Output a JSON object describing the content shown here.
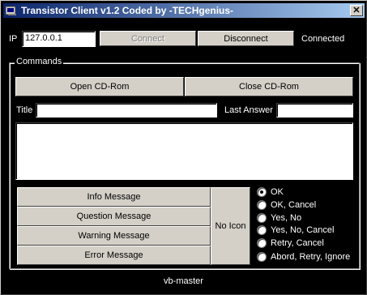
{
  "window": {
    "title": "Transistor Client v1.2 Coded by -TECHgenius-",
    "close_label": "✕"
  },
  "connection": {
    "ip_label": "IP",
    "ip_value": "127.0.0.1",
    "connect_label": "Connect",
    "disconnect_label": "Disconnect",
    "status": "Connected"
  },
  "commands": {
    "frame_label": "Commands",
    "open_cd_label": "Open CD-Rom",
    "close_cd_label": "Close CD-Rom",
    "title_label": "Title",
    "title_value": "",
    "last_answer_label": "Last Answer",
    "last_answer_value": "",
    "message_value": ""
  },
  "messages": {
    "info_label": "Info Message",
    "question_label": "Question Message",
    "warning_label": "Warning Message",
    "error_label": "Error Message",
    "no_icon_label": "No Icon"
  },
  "buttons_options": {
    "ok": "OK",
    "ok_cancel": "OK, Cancel",
    "yes_no": "Yes, No",
    "yes_no_cancel": "Yes, No, Cancel",
    "retry_cancel": "Retry, Cancel",
    "abort_retry_ignore": "Abord, Retry, Ignore",
    "selected": "ok"
  },
  "footer": {
    "credit": "vb-master"
  }
}
